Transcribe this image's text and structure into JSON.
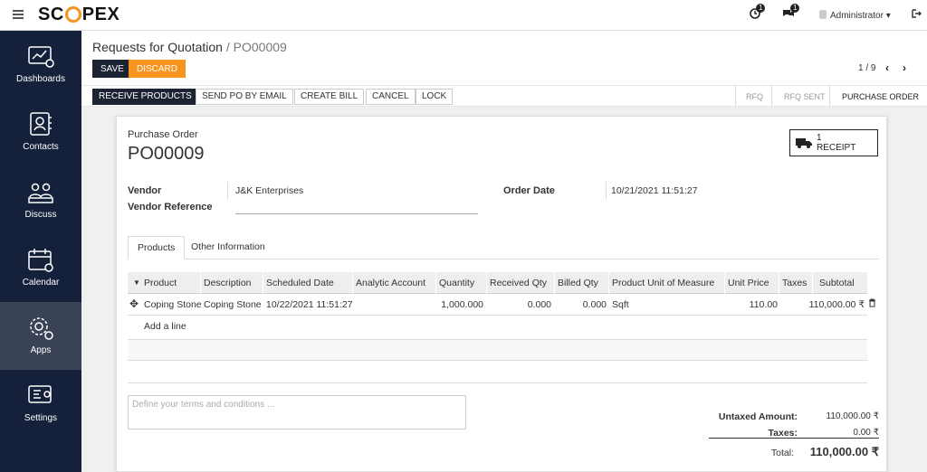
{
  "brand": {
    "logo_pre": "SC",
    "logo_post": "PEX"
  },
  "topbar": {
    "activity_count": "1",
    "messages_count": "1",
    "user": "Administrator",
    "user_caret": "▾"
  },
  "sidebar": {
    "items": [
      {
        "label": "Dashboards",
        "icon": "dashboard-icon"
      },
      {
        "label": "Contacts",
        "icon": "contacts-icon"
      },
      {
        "label": "Discuss",
        "icon": "discuss-icon"
      },
      {
        "label": "Calendar",
        "icon": "calendar-icon"
      },
      {
        "label": "Apps",
        "icon": "apps-icon",
        "active": true
      },
      {
        "label": "Settings",
        "icon": "settings-icon"
      }
    ]
  },
  "breadcrumb": {
    "parent": "Requests for Quotation",
    "sep": "/",
    "current": "PO00009"
  },
  "controls": {
    "save": "SAVE",
    "discard": "DISCARD",
    "pager": "1 / 9"
  },
  "status_buttons": [
    "RECEIVE PRODUCTS",
    "SEND PO BY EMAIL",
    "CREATE BILL",
    "CANCEL",
    "LOCK"
  ],
  "stages": [
    "RFQ",
    "RFQ SENT",
    "PURCHASE ORDER"
  ],
  "order": {
    "doc_label": "Purchase Order",
    "name": "PO00009",
    "receipt_count": "1",
    "receipt_label": "RECEIPT",
    "vendor_label": "Vendor",
    "vendor": "J&K Enterprises",
    "vendor_ref_label": "Vendor Reference",
    "order_date_label": "Order Date",
    "order_date": "10/21/2021 11:51:27"
  },
  "tabs": [
    "Products",
    "Other Information"
  ],
  "lines": {
    "headers": [
      "Product",
      "Description",
      "Scheduled Date",
      "Analytic Account",
      "Quantity",
      "Received Qty",
      "Billed Qty",
      "Product Unit of Measure",
      "Unit Price",
      "Taxes",
      "Subtotal"
    ],
    "rows": [
      {
        "product": "Coping Stone",
        "description": "Coping Stone",
        "scheduled": "10/22/2021 11:51:27",
        "analytic": "",
        "quantity": "1,000.000",
        "received": "0.000",
        "billed": "0.000",
        "uom": "Sqft",
        "unit_price": "110.00",
        "taxes": "",
        "subtotal": "110,000.00 ₹"
      }
    ],
    "add_line": "Add a line"
  },
  "terms_placeholder": "Define your terms and conditions ...",
  "totals": {
    "untaxed_label": "Untaxed Amount:",
    "untaxed": "110,000.00 ₹",
    "taxes_label": "Taxes:",
    "taxes": "0.00 ₹",
    "total_label": "Total:",
    "total": "110,000.00 ₹"
  },
  "colors": {
    "sidebar": "#15213a",
    "accent": "#f7941d",
    "primary": "#1c2433"
  }
}
